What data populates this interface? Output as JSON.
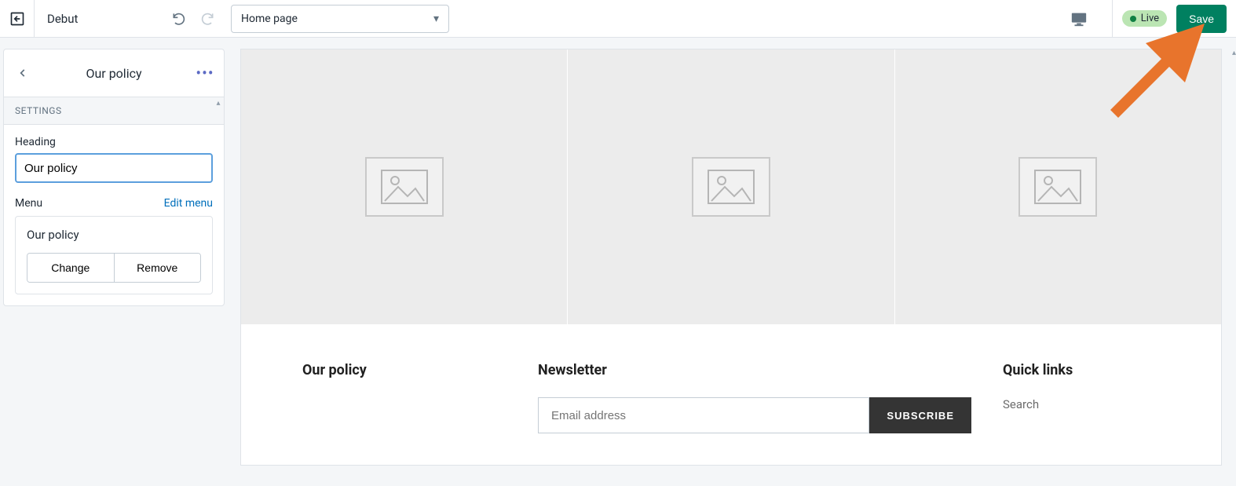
{
  "topbar": {
    "theme_name": "Debut",
    "page_selector": "Home page",
    "live_label": "Live",
    "save_label": "Save"
  },
  "sidebar": {
    "panel_title": "Our policy",
    "settings_label": "SETTINGS",
    "heading_label": "Heading",
    "heading_value": "Our policy",
    "menu_label": "Menu",
    "edit_menu_label": "Edit menu",
    "menu_name": "Our policy",
    "change_label": "Change",
    "remove_label": "Remove"
  },
  "preview": {
    "footer": {
      "policy_heading": "Our policy",
      "newsletter_heading": "Newsletter",
      "email_placeholder": "Email address",
      "subscribe_label": "SUBSCRIBE",
      "quick_links_heading": "Quick links",
      "quick_links": [
        "Search"
      ]
    }
  }
}
